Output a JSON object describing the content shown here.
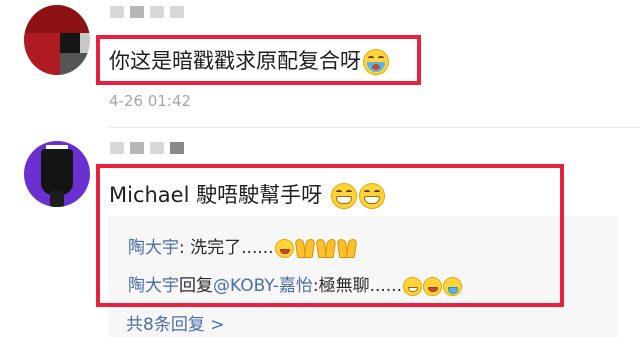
{
  "comments": [
    {
      "text": "你这是暗戳戳求原配复合呀",
      "emoji": "grimacing-face-emoji",
      "timestamp": "4-26 01:42"
    },
    {
      "author": "Michael",
      "text": "駛唔駛幫手呀",
      "emojis": [
        "grin-emoji",
        "grin-emoji"
      ],
      "replies": [
        {
          "author": "陶大宇",
          "separator": ":",
          "text": " 洗完了......",
          "emojis": [
            "laugh-cry-emoji",
            "prayer-emoji",
            "prayer-emoji",
            "prayer-emoji"
          ]
        },
        {
          "author": "陶大宇",
          "reply_word": "回复",
          "mention": "@KOBY-嘉怡",
          "text": ":極無聊......",
          "emojis": [
            "grin-emoji",
            "laugh-cry-emoji",
            "crying-emoji"
          ]
        }
      ],
      "total_replies_label": "共8条回复 >"
    }
  ],
  "colors": {
    "highlight_border": "#e8213f",
    "link_blue": "#4a6ea9",
    "timestamp_gray": "#a6a6a6",
    "reply_background": "#f7f7f7"
  }
}
